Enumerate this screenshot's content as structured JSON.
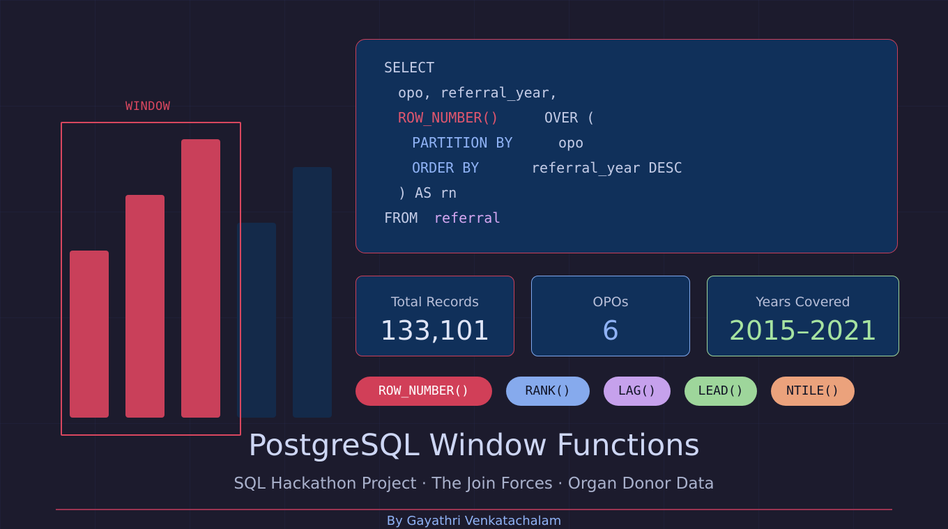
{
  "illustration": {
    "window_label": "WINDOW",
    "bars": [
      {
        "value": 240,
        "in_window": true
      },
      {
        "value": 320,
        "in_window": true
      },
      {
        "value": 400,
        "in_window": true
      },
      {
        "value": 280,
        "in_window": false
      },
      {
        "value": 360,
        "in_window": false
      }
    ]
  },
  "code": {
    "select_kw": "SELECT",
    "columns": "opo, referral_year,",
    "row_number_fn": "ROW_NUMBER()",
    "over_kw": "OVER (",
    "partition_kw": "PARTITION BY",
    "partition_col": "opo",
    "order_kw": "ORDER BY",
    "order_col": "referral_year DESC",
    "alias": ") AS rn",
    "from_kw": "FROM",
    "table": "referral"
  },
  "stats": [
    {
      "label": "Total Records",
      "value": "133,101"
    },
    {
      "label": "OPOs",
      "value": "6"
    },
    {
      "label": "Years Covered",
      "value": "2015–2021"
    }
  ],
  "functions": [
    "ROW_NUMBER()",
    "RANK()",
    "LAG()",
    "LEAD()",
    "NTILE()"
  ],
  "title": "PostgreSQL Window Functions",
  "subtitle": "SQL Hackathon Project · The Join Forces · Organ Donor Data",
  "author": "By Gayathri Venkatachalam",
  "colors": {
    "background": "#1c1b2d",
    "accent_red": "#d9475f",
    "panel": "#10305a",
    "blue": "#8fb2f5",
    "purple": "#c6a1ec",
    "green": "#a6e3a1",
    "orange": "#eba27c"
  }
}
